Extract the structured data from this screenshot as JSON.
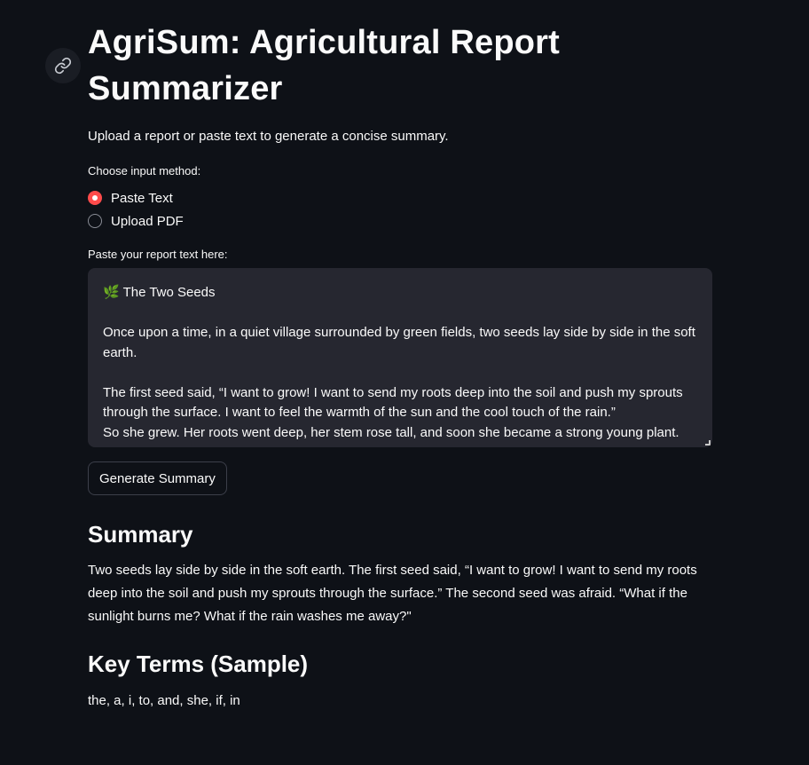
{
  "header": {
    "title": "AgriSum: Agricultural Report Summarizer",
    "subtitle": "Upload a report or paste text to generate a concise summary."
  },
  "input_method": {
    "label": "Choose input method:",
    "options": [
      {
        "label": "Paste Text",
        "selected": true
      },
      {
        "label": "Upload PDF",
        "selected": false
      }
    ]
  },
  "report_text": {
    "label": "Paste your report text here:",
    "value": "🌿 The Two Seeds\n\nOnce upon a time, in a quiet village surrounded by green fields, two seeds lay side by side in the soft earth.\n\nThe first seed said, “I want to grow! I want to send my roots deep into the soil and push my sprouts through the surface. I want to feel the warmth of the sun and the cool touch of the rain.”\nSo she grew. Her roots went deep, her stem rose tall, and soon she became a strong young plant."
  },
  "actions": {
    "generate_label": "Generate Summary"
  },
  "summary": {
    "heading": "Summary",
    "text": "Two seeds lay side by side in the soft earth. The first seed said, “I want to grow! I want to send my roots deep into the soil and push my sprouts through the surface.” The second seed was afraid. “What if the sunlight burns me? What if the rain washes me away?\""
  },
  "key_terms": {
    "heading": "Key Terms (Sample)",
    "text": "the, a, i, to, and, she, if, in"
  },
  "colors": {
    "background": "#0e1117",
    "accent": "#ff4b4b",
    "input_background": "#262730"
  },
  "icons": {
    "anchor": "link-icon"
  }
}
